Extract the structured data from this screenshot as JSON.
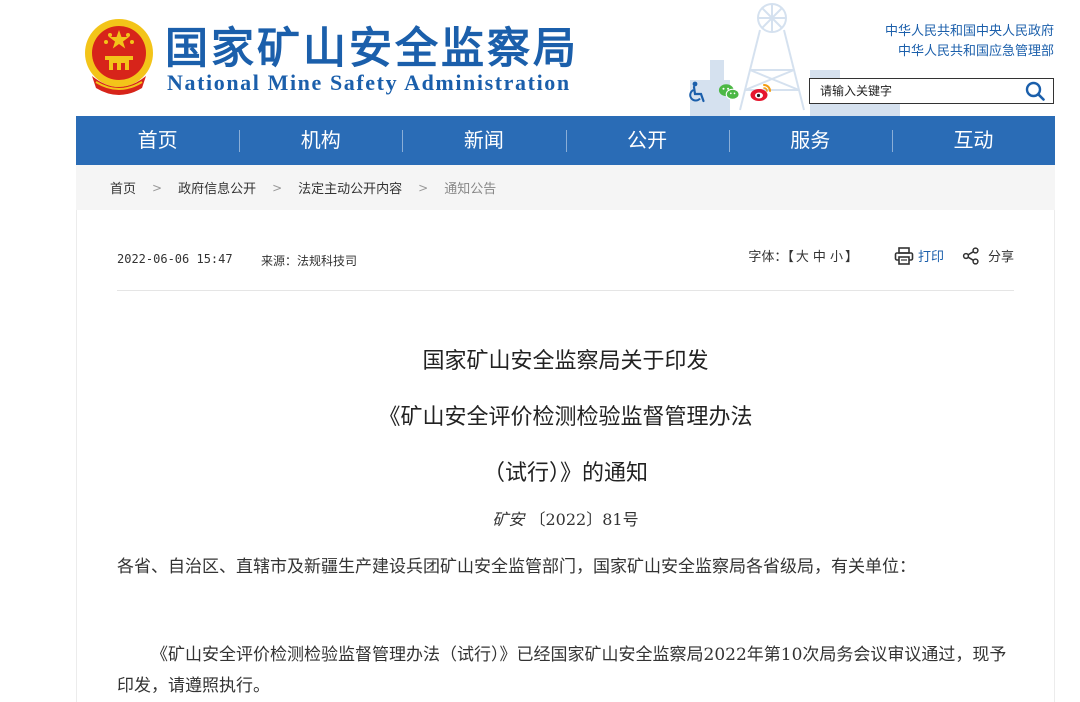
{
  "header": {
    "title_cn": "国家矿山安全监察局",
    "title_en": "National Mine Safety Administration",
    "gov_links": [
      "中华人民共和国中央人民政府",
      "中华人民共和国应急管理部"
    ],
    "search": {
      "placeholder": "请输入关键字"
    },
    "icons": [
      "accessibility-icon",
      "wechat-icon",
      "weibo-icon",
      "search-icon"
    ]
  },
  "nav": {
    "items": [
      "首页",
      "机构",
      "新闻",
      "公开",
      "服务",
      "互动"
    ]
  },
  "breadcrumb": {
    "items": [
      "首页",
      "政府信息公开",
      "法定主动公开内容",
      "通知公告"
    ],
    "separator": ">"
  },
  "article": {
    "date": "2022-06-06 15:47",
    "source": "来源：法规科技司",
    "font_label": "字体：【",
    "font_sizes": [
      "大",
      "中",
      "小"
    ],
    "font_close": "】",
    "print_label": "打印",
    "share_label": "分享",
    "title_lines": [
      "国家矿山安全监察局关于印发",
      "《矿山安全评价检测检验监督管理办法",
      "（试行）》的通知"
    ],
    "doc_number_prefix": "矿安",
    "doc_number_rest": "〔2022〕81号",
    "paragraphs": [
      "各省、自治区、直辖市及新疆生产建设兵团矿山安全监管部门，国家矿山安全监察局各省级局，有关单位：",
      "《矿山安全评价检测检验监督管理办法（试行）》已经国家矿山安全监察局2022年第10次局务会议审议通过，现予印发，请遵照执行。"
    ]
  },
  "colors": {
    "brand_blue": "#1b5fab",
    "nav_blue": "#2a6cb6",
    "emblem_red": "#d7241a",
    "emblem_gold": "#f3c419",
    "weibo_red": "#e6162d",
    "wechat_green": "#4cb845"
  }
}
